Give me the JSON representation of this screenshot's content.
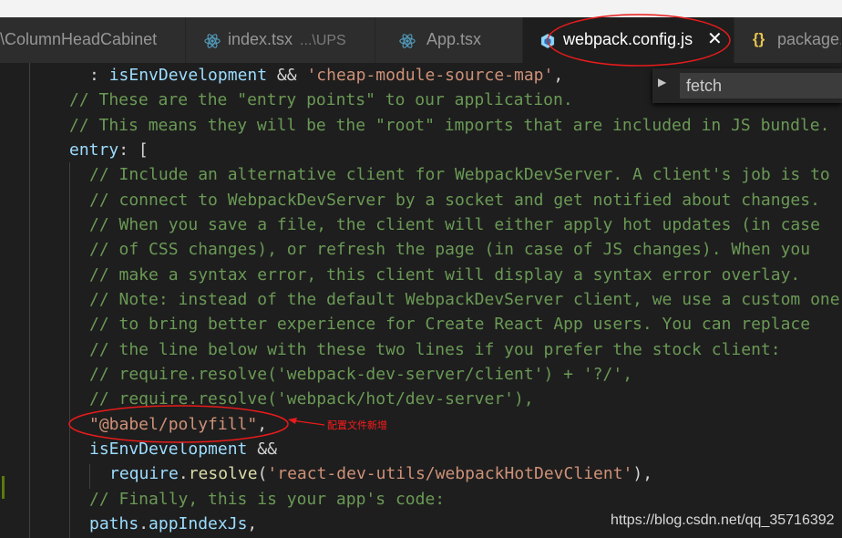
{
  "tabs": [
    {
      "label": "\\ColumnHeadCabinet",
      "desc": ""
    },
    {
      "label": "index.tsx",
      "desc": "...\\UPS"
    },
    {
      "label": "App.tsx",
      "desc": ""
    },
    {
      "label": "webpack.config.js",
      "desc": ""
    },
    {
      "label": "package.",
      "desc": ""
    }
  ],
  "find_widget": {
    "value": "fetch"
  },
  "code": {
    "l1": {
      "p1": ": ",
      "v1": "isEnvDevelopment",
      "p2": " && ",
      "s1": "'cheap-module-source-map'",
      "p3": ","
    },
    "l2": "// These are the \"entry points\" to our application.",
    "l3": "// This means they will be the \"root\" imports that are included in JS bundle.",
    "l4": {
      "v1": "entry",
      "p1": ": ["
    },
    "l5": "// Include an alternative client for WebpackDevServer. A client's job is to",
    "l6": "// connect to WebpackDevServer by a socket and get notified about changes.",
    "l7": "// When you save a file, the client will either apply hot updates (in case",
    "l8": "// of CSS changes), or refresh the page (in case of JS changes). When you",
    "l9": "// make a syntax error, this client will display a syntax error overlay.",
    "l10": "// Note: instead of the default WebpackDevServer client, we use a custom one",
    "l11": "// to bring better experience for Create React App users. You can replace",
    "l12": "// the line below with these two lines if you prefer the stock client:",
    "l13": "// require.resolve('webpack-dev-server/client') + '?/',",
    "l14": "// require.resolve('webpack/hot/dev-server'),",
    "l15": {
      "s1": "\"@babel/polyfill\"",
      "p1": ","
    },
    "l16": {
      "v1": "isEnvDevelopment",
      "p1": " &&"
    },
    "l17": {
      "v1": "require",
      "p1": ".",
      "f1": "resolve",
      "p2": "(",
      "s1": "'react-dev-utils/webpackHotDevClient'",
      "p3": "),"
    },
    "l18": "// Finally, this is your app's code:",
    "l19": {
      "v1": "paths",
      "p1": ".",
      "v2": "appIndexJs",
      "p2": ","
    }
  },
  "annotation": {
    "note": "配置文件新增",
    "color": "#e81b1b"
  },
  "watermark": "https://blog.csdn.net/qq_35716392",
  "colors": {
    "comment": "#6a9955",
    "string": "#ce9178",
    "variable": "#9cdcfe",
    "function": "#dcdcaa",
    "background": "#1e1e1e"
  },
  "icons": {
    "react": "react-icon",
    "close": "close-icon",
    "json": "json-braces-icon",
    "toggle": "chevron-right-icon"
  }
}
